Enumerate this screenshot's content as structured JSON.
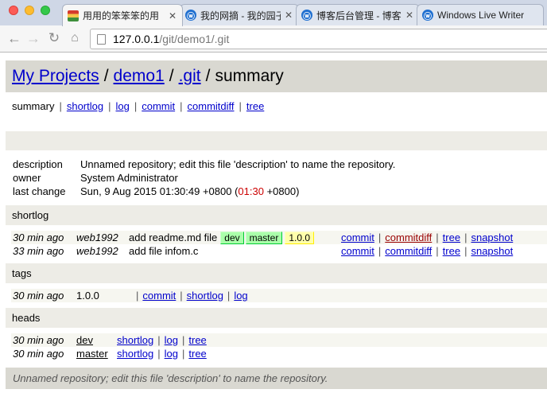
{
  "browser": {
    "tabs": [
      {
        "label": "用用的笨笨笨的用",
        "icon": "china-flag-icon",
        "active": true
      },
      {
        "label": "我的网摘 - 我的园子",
        "icon": "blog-icon",
        "active": false
      },
      {
        "label": "博客后台管理 - 博客",
        "icon": "blog-icon",
        "active": false
      },
      {
        "label": "Windows Live Writer",
        "icon": "blog-icon",
        "active": false
      }
    ],
    "close_glyph": "✕",
    "url_host": "127.0.0.1",
    "url_path": "/git/demo1/.git"
  },
  "header": {
    "crumbs": [
      "My Projects",
      "demo1",
      ".git"
    ],
    "sep": "/",
    "current": "summary"
  },
  "nav": {
    "current": "summary",
    "links": [
      "shortlog",
      "log",
      "commit",
      "commitdiff",
      "tree"
    ],
    "sep": "|"
  },
  "project": {
    "description_label": "description",
    "description": "Unnamed repository; edit this file 'description' to name the repository.",
    "owner_label": "owner",
    "owner": "System Administrator",
    "last_change_label": "last change",
    "last_change_prefix": "Sun, 9 Aug 2015 01:30:49 +0800 (",
    "last_change_local": "01:30",
    "last_change_suffix": " +0800)"
  },
  "shortlog": {
    "title": "shortlog",
    "rows": [
      {
        "age": "30 min ago",
        "author": "web1992",
        "message": "add readme.md file",
        "refs_head": [
          "dev",
          "master"
        ],
        "refs_tag": [
          "1.0.0"
        ],
        "links": [
          "commit",
          "commitdiff",
          "tree",
          "snapshot"
        ]
      },
      {
        "age": "33 min ago",
        "author": "web1992",
        "message": "add file infom.c",
        "refs_head": [],
        "refs_tag": [],
        "links": [
          "commit",
          "commitdiff",
          "tree",
          "snapshot"
        ]
      }
    ]
  },
  "tags": {
    "title": "tags",
    "rows": [
      {
        "age": "30 min ago",
        "name": "1.0.0",
        "links": [
          "commit",
          "shortlog",
          "log"
        ]
      }
    ]
  },
  "heads": {
    "title": "heads",
    "rows": [
      {
        "age": "30 min ago",
        "name": "dev",
        "links": [
          "shortlog",
          "log",
          "tree"
        ]
      },
      {
        "age": "30 min ago",
        "name": "master",
        "links": [
          "shortlog",
          "log",
          "tree"
        ]
      }
    ]
  },
  "footer": {
    "text": "Unnamed repository; edit this file 'description' to name the repository."
  }
}
